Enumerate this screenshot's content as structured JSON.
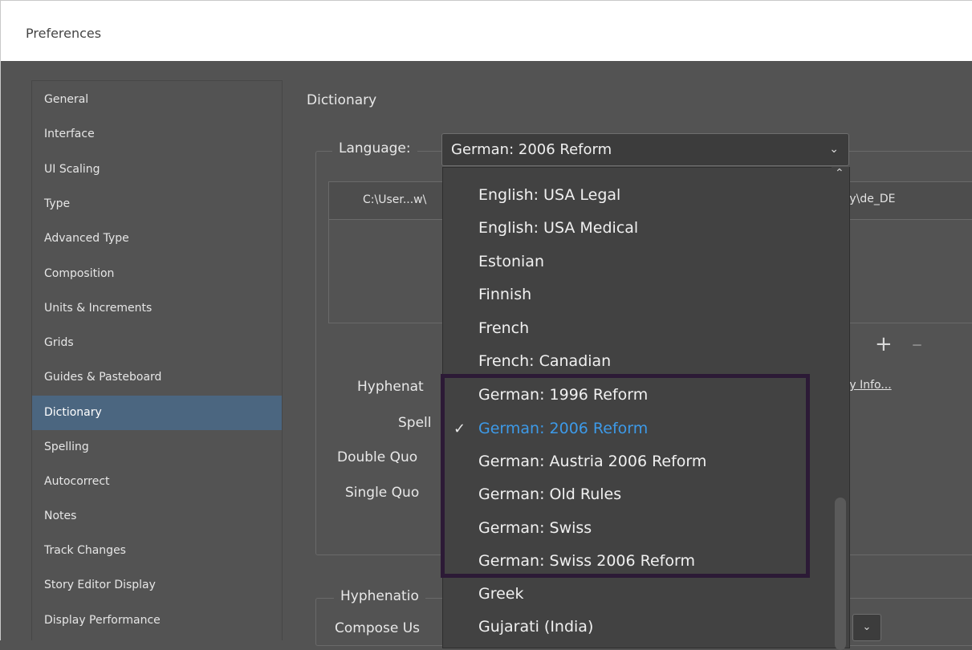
{
  "window": {
    "title": "Preferences"
  },
  "sidebar": {
    "items": [
      {
        "label": "General"
      },
      {
        "label": "Interface"
      },
      {
        "label": "UI Scaling"
      },
      {
        "label": "Type"
      },
      {
        "label": "Advanced Type"
      },
      {
        "label": "Composition"
      },
      {
        "label": "Units & Increments"
      },
      {
        "label": "Grids"
      },
      {
        "label": "Guides & Pasteboard"
      },
      {
        "label": "Dictionary",
        "selected": true
      },
      {
        "label": "Spelling"
      },
      {
        "label": "Autocorrect"
      },
      {
        "label": "Notes"
      },
      {
        "label": "Track Changes"
      },
      {
        "label": "Story Editor Display"
      },
      {
        "label": "Display Performance"
      }
    ]
  },
  "panel": {
    "title": "Dictionary",
    "language_label": "Language:",
    "language_value": "German: 2006 Reform",
    "path_left": "C:\\User...w\\",
    "path_right": "ary\\de_DE",
    "add_button": "+",
    "remove_button": "–",
    "dictionary_info_link": "ary Info...",
    "labels": {
      "hyphenation": "Hyphenat",
      "spelling": "Spell",
      "double_quotes": "Double Quo",
      "single_quotes": "Single Quo"
    },
    "hyphenation_group_label": "Hyphenatio",
    "compose_label": "Compose Us"
  },
  "dropdown": {
    "items": [
      {
        "label": "English: USA Legal"
      },
      {
        "label": "English: USA Medical"
      },
      {
        "label": "Estonian"
      },
      {
        "label": "Finnish"
      },
      {
        "label": "French"
      },
      {
        "label": "French: Canadian"
      },
      {
        "label": "German: 1996 Reform"
      },
      {
        "label": "German: 2006 Reform",
        "selected": true
      },
      {
        "label": "German: Austria 2006 Reform"
      },
      {
        "label": "German: Old Rules"
      },
      {
        "label": "German: Swiss"
      },
      {
        "label": "German: Swiss 2006 Reform"
      },
      {
        "label": "Greek"
      },
      {
        "label": "Gujarati (India)"
      }
    ],
    "check_glyph": "✓"
  },
  "colors": {
    "selected_sidebar": "#4b6680",
    "selected_dropdown_text": "#3d9ae8",
    "highlight_border": "#2c1a36"
  }
}
